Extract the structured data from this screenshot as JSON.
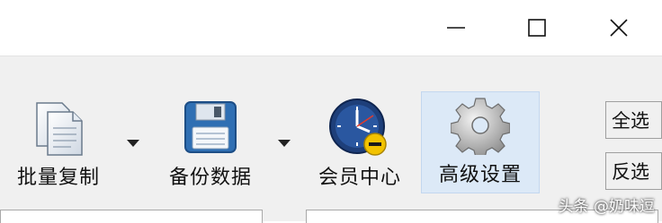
{
  "window": {
    "minimize_icon": "minimize-icon",
    "maximize_icon": "maximize-icon",
    "close_icon": "close-icon"
  },
  "toolbar": {
    "items": [
      {
        "label": "批量复制",
        "icon": "copy-documents-icon",
        "has_dropdown": true
      },
      {
        "label": "备份数据",
        "icon": "floppy-disk-icon",
        "has_dropdown": true
      },
      {
        "label": "会员中心",
        "icon": "clock-minus-icon",
        "has_dropdown": false
      },
      {
        "label": "高级设置",
        "icon": "gear-icon",
        "has_dropdown": false,
        "selected": true
      }
    ]
  },
  "side_buttons": {
    "select_all": "全选",
    "invert_selection": "反选"
  },
  "watermark": "头条 @奶味逗",
  "colors": {
    "toolbar_bg": "#f0f0f0",
    "selected_bg": "#dce9f7",
    "floppy_blue": "#2f6fb3",
    "clock_blue": "#1e3f7a",
    "badge_yellow": "#f2c200"
  }
}
